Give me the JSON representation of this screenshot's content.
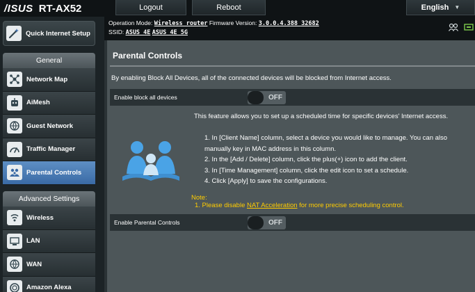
{
  "header": {
    "brand": "/ISUS",
    "model": "RT-AX52",
    "logout_label": "Logout",
    "reboot_label": "Reboot",
    "language": "English"
  },
  "status": {
    "operation_mode_label": "Operation Mode:",
    "operation_mode": "Wireless router",
    "firmware_label": "Firmware Version:",
    "firmware": "3.0.0.4.388_32682",
    "ssid_label": "SSID:",
    "ssid_1": "ASUS_4E",
    "ssid_2": "ASUS_4E_5G"
  },
  "sidebar": {
    "quick_setup": "Quick Internet Setup",
    "general_title": "General",
    "general_items": [
      {
        "label": "Network Map",
        "icon": "network-map-icon"
      },
      {
        "label": "AiMesh",
        "icon": "aimesh-icon"
      },
      {
        "label": "Guest Network",
        "icon": "guest-network-icon"
      },
      {
        "label": "Traffic Manager",
        "icon": "traffic-manager-icon"
      },
      {
        "label": "Parental Controls",
        "icon": "parental-controls-icon",
        "active": true
      }
    ],
    "advanced_title": "Advanced Settings",
    "advanced_items": [
      {
        "label": "Wireless",
        "icon": "wireless-icon"
      },
      {
        "label": "LAN",
        "icon": "lan-icon"
      },
      {
        "label": "WAN",
        "icon": "wan-icon"
      },
      {
        "label": "Amazon Alexa",
        "icon": "alexa-icon"
      }
    ]
  },
  "main": {
    "title": "Parental Controls",
    "description": "By enabling Block All Devices, all of the connected devices will be blocked from Internet access.",
    "block_all_label": "Enable block all devices",
    "block_all_state": "OFF",
    "intro": "This feature allows you to set up a scheduled time for specific devices' Internet access.",
    "step1": "1. In [Client Name] column, select a device you would like to manage. You can also manually key in MAC address in this column.",
    "step2": "2. In the [Add / Delete] column, click the plus(+) icon to add the client.",
    "step3": "3. In [Time Management] column, click the edit icon to set a schedule.",
    "step4": "4. Click [Apply] to save the configurations.",
    "note_title": "Note:",
    "note_prefix": "1. Please disable",
    "note_link": "NAT Acceleration",
    "note_suffix": "for more precise scheduling control.",
    "enable_label": "Enable Parental Controls",
    "enable_state": "OFF"
  },
  "colors": {
    "active_nav": "#4a7bb5",
    "note": "#ffcc00",
    "panel": "#4d5659"
  }
}
